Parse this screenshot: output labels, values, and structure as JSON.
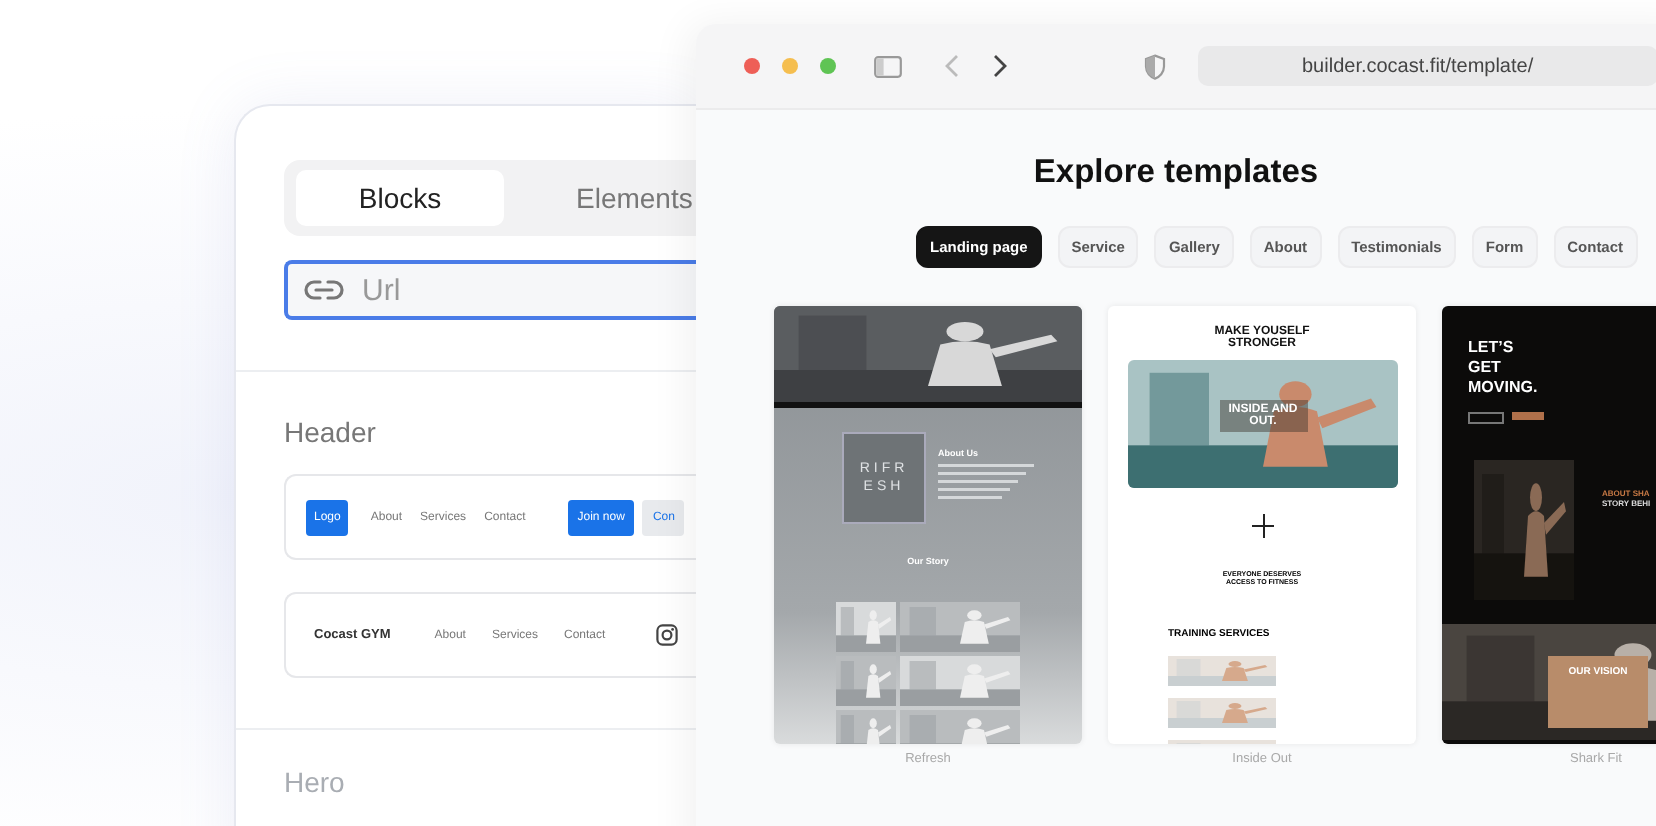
{
  "left_panel": {
    "tabs": [
      {
        "label": "Blocks",
        "selected": true
      },
      {
        "label": "Elements",
        "selected": false
      }
    ],
    "url_field": {
      "placeholder": "Url"
    },
    "sections": [
      {
        "title": "Header",
        "blocks": [
          {
            "kind": "nav_buttons",
            "logo": "Logo",
            "links": [
              "About",
              "Services",
              "Contact"
            ],
            "buttons": [
              "Join now",
              "Con"
            ]
          },
          {
            "kind": "nav_social",
            "brand": "Cocast GYM",
            "links": [
              "About",
              "Services",
              "Contact"
            ]
          }
        ]
      },
      {
        "title": "Hero"
      }
    ]
  },
  "browser": {
    "address": "builder.cocast.fit/template/",
    "title": "Explore templates",
    "filters": [
      {
        "label": "Landing page",
        "selected": true
      },
      {
        "label": "Service",
        "selected": false
      },
      {
        "label": "Gallery",
        "selected": false
      },
      {
        "label": "About",
        "selected": false
      },
      {
        "label": "Testimonials",
        "selected": false
      },
      {
        "label": "Form",
        "selected": false
      },
      {
        "label": "Contact",
        "selected": false
      }
    ],
    "templates": [
      {
        "kind": "grey",
        "logo": [
          "RIFR",
          "ESH"
        ],
        "headings": [
          "About Us",
          "Our Story"
        ],
        "caption": "Refresh"
      },
      {
        "kind": "light",
        "headline": "MAKE YOUSELF STRONGER",
        "overlay": "INSIDE AND OUT.",
        "tagline": "EVERYONE DESERVES ACCESS TO FITNESS",
        "section": "TRAINING SERVICES",
        "caption": "Inside Out"
      },
      {
        "kind": "dark",
        "headline": "LET’S GET MOVING.",
        "about": [
          "ABOUT SHA",
          "STORY BEHI"
        ],
        "box": "OUR VISION",
        "caption": "Shark Fit"
      }
    ]
  }
}
